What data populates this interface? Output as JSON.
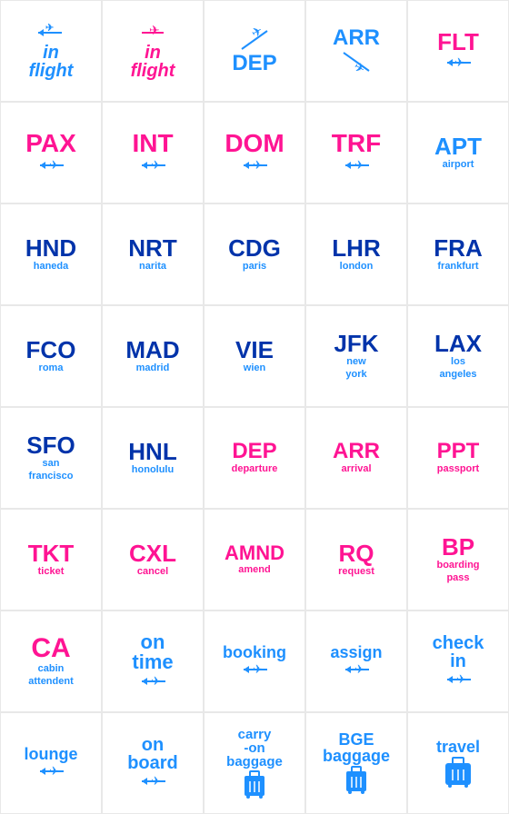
{
  "cells": [
    {
      "id": "in-flight-1",
      "label": "in\nflight",
      "sublabel": "",
      "labelColor": "blue",
      "sublabelColor": "blue",
      "iconTop": "←✈",
      "iconDir": "left",
      "row": 1
    },
    {
      "id": "in-flight-2",
      "label": "in\nflight",
      "sublabel": "",
      "labelColor": "pink",
      "sublabelColor": "pink",
      "iconTop": "✈→",
      "iconDir": "right",
      "row": 1
    },
    {
      "id": "dep",
      "label": "DEP",
      "sublabel": "",
      "labelColor": "blue",
      "sublabelColor": "blue",
      "iconTop": "↗✈",
      "iconDir": "diag",
      "row": 1
    },
    {
      "id": "arr",
      "label": "ARR",
      "sublabel": "",
      "labelColor": "blue",
      "sublabelColor": "blue",
      "iconTop": "✈↙",
      "iconDir": "diag2",
      "row": 1
    },
    {
      "id": "flt",
      "label": "FLT",
      "sublabel": "",
      "labelColor": "pink",
      "sublabelColor": "pink",
      "iconTop": "←✈",
      "iconDir": "left2",
      "row": 1
    },
    {
      "id": "pax",
      "label": "PAX",
      "sublabel": "",
      "labelColor": "pink",
      "sublabelColor": "pink",
      "iconBottom": "←✈",
      "row": 2
    },
    {
      "id": "int",
      "label": "INT",
      "sublabel": "",
      "labelColor": "pink",
      "sublabelColor": "pink",
      "iconBottom": "←✈",
      "row": 2
    },
    {
      "id": "dom",
      "label": "DOM",
      "sublabel": "",
      "labelColor": "pink",
      "sublabelColor": "pink",
      "iconBottom": "←✈",
      "row": 2
    },
    {
      "id": "trf",
      "label": "TRF",
      "sublabel": "",
      "labelColor": "pink",
      "sublabelColor": "pink",
      "iconBottom": "←✈",
      "row": 2
    },
    {
      "id": "apt",
      "label": "APT",
      "sublabel": "airport",
      "labelColor": "blue",
      "sublabelColor": "blue",
      "iconBottom": "",
      "row": 2
    },
    {
      "id": "hnd",
      "label": "HND",
      "sublabel": "haneda",
      "labelColor": "dark-blue",
      "sublabelColor": "blue",
      "iconBottom": "",
      "row": 3
    },
    {
      "id": "nrt",
      "label": "NRT",
      "sublabel": "narita",
      "labelColor": "dark-blue",
      "sublabelColor": "blue",
      "iconBottom": "",
      "row": 3
    },
    {
      "id": "cdg",
      "label": "CDG",
      "sublabel": "paris",
      "labelColor": "dark-blue",
      "sublabelColor": "blue",
      "iconBottom": "",
      "row": 3
    },
    {
      "id": "lhr",
      "label": "LHR",
      "sublabel": "london",
      "labelColor": "dark-blue",
      "sublabelColor": "blue",
      "iconBottom": "",
      "row": 3
    },
    {
      "id": "fra",
      "label": "FRA",
      "sublabel": "frankfurt",
      "labelColor": "dark-blue",
      "sublabelColor": "blue",
      "iconBottom": "",
      "row": 3
    },
    {
      "id": "fco",
      "label": "FCO",
      "sublabel": "roma",
      "labelColor": "dark-blue",
      "sublabelColor": "blue",
      "iconBottom": "",
      "row": 4
    },
    {
      "id": "mad",
      "label": "MAD",
      "sublabel": "madrid",
      "labelColor": "dark-blue",
      "sublabelColor": "blue",
      "iconBottom": "",
      "row": 4
    },
    {
      "id": "vie",
      "label": "VIE",
      "sublabel": "wien",
      "labelColor": "dark-blue",
      "sublabelColor": "blue",
      "iconBottom": "",
      "row": 4
    },
    {
      "id": "jfk",
      "label": "JFK",
      "sublabel": "new\nyork",
      "labelColor": "dark-blue",
      "sublabelColor": "blue",
      "iconBottom": "",
      "row": 4
    },
    {
      "id": "lax",
      "label": "LAX",
      "sublabel": "los\nangeles",
      "labelColor": "dark-blue",
      "sublabelColor": "blue",
      "iconBottom": "",
      "row": 4
    },
    {
      "id": "sfo",
      "label": "SFO",
      "sublabel": "san\nfrancisco",
      "labelColor": "dark-blue",
      "sublabelColor": "blue",
      "iconBottom": "",
      "row": 5
    },
    {
      "id": "hnl",
      "label": "HNL",
      "sublabel": "honolulu",
      "labelColor": "dark-blue",
      "sublabelColor": "blue",
      "iconBottom": "",
      "row": 5
    },
    {
      "id": "dep2",
      "label": "DEP",
      "sublabel": "departure",
      "labelColor": "pink",
      "sublabelColor": "pink",
      "iconBottom": "",
      "row": 5
    },
    {
      "id": "arr2",
      "label": "ARR",
      "sublabel": "arrival",
      "labelColor": "pink",
      "sublabelColor": "pink",
      "iconBottom": "",
      "row": 5
    },
    {
      "id": "ppt",
      "label": "PPT",
      "sublabel": "passport",
      "labelColor": "pink",
      "sublabelColor": "pink",
      "iconBottom": "",
      "row": 5
    },
    {
      "id": "tkt",
      "label": "TKT",
      "sublabel": "ticket",
      "labelColor": "pink",
      "sublabelColor": "pink",
      "iconBottom": "",
      "row": 6
    },
    {
      "id": "cxl",
      "label": "CXL",
      "sublabel": "cancel",
      "labelColor": "pink",
      "sublabelColor": "pink",
      "iconBottom": "",
      "row": 6
    },
    {
      "id": "amnd",
      "label": "AMND",
      "sublabel": "amend",
      "labelColor": "pink",
      "sublabelColor": "pink",
      "iconBottom": "",
      "row": 6
    },
    {
      "id": "rq",
      "label": "RQ",
      "sublabel": "request",
      "labelColor": "pink",
      "sublabelColor": "pink",
      "iconBottom": "",
      "row": 6
    },
    {
      "id": "bp",
      "label": "BP",
      "sublabel": "boarding\npass",
      "labelColor": "pink",
      "sublabelColor": "pink",
      "iconBottom": "",
      "row": 6
    },
    {
      "id": "ca",
      "label": "CA",
      "sublabel": "cabin\nattendent",
      "labelColor": "pink",
      "sublabelColor": "blue",
      "iconBottom": "",
      "row": 7
    },
    {
      "id": "on-time",
      "label": "on\ntime",
      "sublabel": "",
      "labelColor": "blue",
      "sublabelColor": "blue",
      "iconBottom": "←✈",
      "row": 7
    },
    {
      "id": "booking",
      "label": "booking",
      "sublabel": "",
      "labelColor": "blue",
      "sublabelColor": "blue",
      "iconBottom": "←✈",
      "row": 7
    },
    {
      "id": "assign",
      "label": "assign",
      "sublabel": "",
      "labelColor": "blue",
      "sublabelColor": "blue",
      "iconBottom": "←✈",
      "row": 7
    },
    {
      "id": "check-in",
      "label": "check\nin",
      "sublabel": "",
      "labelColor": "blue",
      "sublabelColor": "blue",
      "iconBottom": "←✈",
      "row": 7
    },
    {
      "id": "lounge",
      "label": "lounge",
      "sublabel": "",
      "labelColor": "blue",
      "sublabelColor": "blue",
      "iconBottom": "←✈",
      "row": 8
    },
    {
      "id": "on-board",
      "label": "on\nboard",
      "sublabel": "",
      "labelColor": "blue",
      "sublabelColor": "blue",
      "iconBottom": "←✈",
      "row": 8
    },
    {
      "id": "carry-on",
      "label": "carry\n-on\nbaggage",
      "sublabel": "",
      "labelColor": "blue",
      "sublabelColor": "blue",
      "iconBottom": "suitcase",
      "row": 8
    },
    {
      "id": "bggage",
      "label": "BGE\nbaggage",
      "sublabel": "",
      "labelColor": "blue",
      "sublabelColor": "blue",
      "iconBottom": "suitcase",
      "row": 8
    },
    {
      "id": "travel",
      "label": "travel",
      "sublabel": "",
      "labelColor": "blue",
      "sublabelColor": "blue",
      "iconBottom": "suitcase",
      "row": 8
    }
  ],
  "colors": {
    "pink": "#FF1493",
    "blue": "#1E90FF",
    "dark-blue": "#0033AA"
  }
}
